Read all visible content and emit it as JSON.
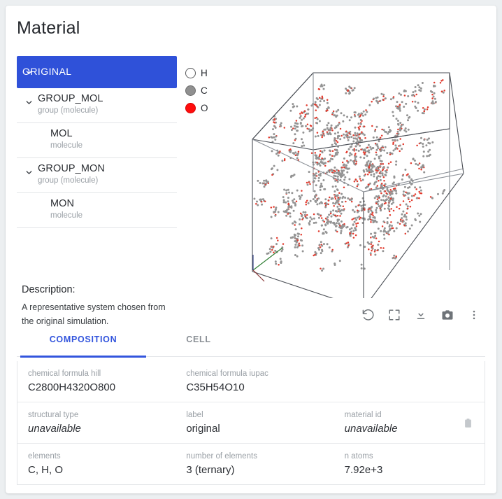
{
  "header": {
    "title": "Material"
  },
  "tree": {
    "items": [
      {
        "label": "ORIGINAL",
        "sub": "",
        "depth": 0,
        "selected": true,
        "chevron": "chevron-down-icon"
      },
      {
        "label": "GROUP_MOL",
        "sub": "group (molecule)",
        "depth": 1,
        "selected": false,
        "chevron": "chevron-down-icon"
      },
      {
        "label": "MOL",
        "sub": "molecule",
        "depth": 2,
        "selected": false,
        "chevron": ""
      },
      {
        "label": "GROUP_MON",
        "sub": "group (molecule)",
        "depth": 1,
        "selected": false,
        "chevron": "chevron-down-icon"
      },
      {
        "label": "MON",
        "sub": "molecule",
        "depth": 2,
        "selected": false,
        "chevron": ""
      }
    ]
  },
  "legend": {
    "items": [
      {
        "symbol": "H",
        "color": "#ffffff",
        "border": "#58595b"
      },
      {
        "symbol": "C",
        "color": "#909090",
        "border": "#6e6e6e"
      },
      {
        "symbol": "O",
        "color": "#ff0d0d",
        "border": "#d60000"
      }
    ]
  },
  "viewer": {
    "name": "structure-viewer",
    "toolbar": [
      {
        "icon": "reset-rotate-icon",
        "name": "reset-view-button"
      },
      {
        "icon": "fullscreen-icon",
        "name": "fullscreen-button"
      },
      {
        "icon": "download-icon",
        "name": "download-button"
      },
      {
        "icon": "camera-icon",
        "name": "screenshot-button"
      },
      {
        "icon": "more-vertical-icon",
        "name": "more-options-button"
      }
    ]
  },
  "description": {
    "title": "Description:",
    "line1": "A representative system chosen from",
    "line2": "the original simulation."
  },
  "tabs": [
    {
      "label": "COMPOSITION",
      "active": true
    },
    {
      "label": "CELL",
      "active": false
    }
  ],
  "table": {
    "rows": [
      {
        "cells": [
          {
            "key": "chemical formula hill",
            "value": "C2800H4320O800",
            "italic": false
          },
          {
            "key": "chemical formula iupac",
            "value": "C35H54O10",
            "italic": false
          },
          {
            "key": "",
            "value": "",
            "italic": false
          }
        ],
        "copy": false
      },
      {
        "cells": [
          {
            "key": "structural type",
            "value": "unavailable",
            "italic": true
          },
          {
            "key": "label",
            "value": "original",
            "italic": false
          },
          {
            "key": "material id",
            "value": "unavailable",
            "italic": true
          }
        ],
        "copy": true
      },
      {
        "cells": [
          {
            "key": "elements",
            "value": "C, H, O",
            "italic": false
          },
          {
            "key": "number of elements",
            "value": "3 (ternary)",
            "italic": false
          },
          {
            "key": "n atoms",
            "value": "7.92e+3",
            "italic": false
          }
        ],
        "copy": false
      }
    ]
  },
  "colors": {
    "accent": "#3355dd",
    "selected_node": "#2f51d9",
    "muted_text": "#9aa0a6",
    "body_text": "#2c2f34",
    "page_bg": "#eceff1"
  }
}
